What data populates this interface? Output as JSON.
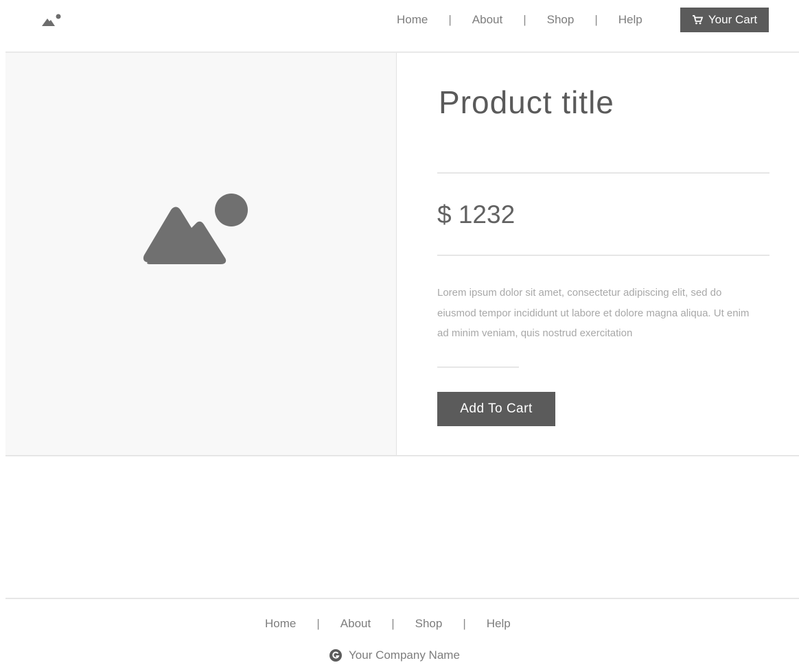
{
  "header": {
    "logo_icon": "image-mountain-icon",
    "nav": [
      {
        "label": "Home"
      },
      {
        "label": "About"
      },
      {
        "label": "Shop"
      },
      {
        "label": "Help"
      }
    ],
    "separator": "|",
    "cart_label": "Your Cart",
    "cart_icon": "cart-icon"
  },
  "product": {
    "image_icon": "image-placeholder-icon",
    "title": "Product title",
    "price": "$ 1232",
    "description": "Lorem ipsum dolor sit amet, consectetur adipiscing elit, sed do eiusmod tempor incididunt ut labore et dolore magna aliqua. Ut enim ad minim veniam, quis nostrud exercitation",
    "add_to_cart_label": "Add To Cart"
  },
  "footer": {
    "nav": [
      {
        "label": "Home"
      },
      {
        "label": "About"
      },
      {
        "label": "Shop"
      },
      {
        "label": "Help"
      }
    ],
    "company_icon": "company-logo-icon",
    "company_name": "Your Company Name"
  },
  "colors": {
    "button_bg": "#5b5b5b",
    "image_panel_bg": "#f8f8f8",
    "divider": "#e6e6e6"
  }
}
